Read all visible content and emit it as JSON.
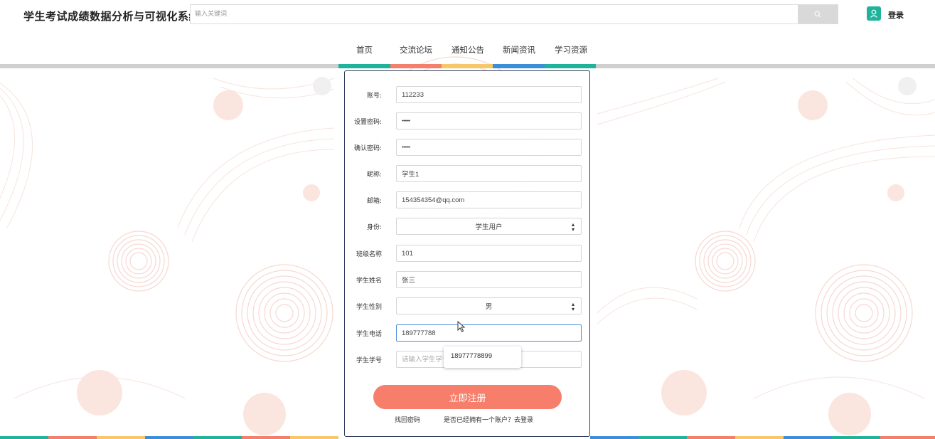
{
  "header": {
    "site_title": "学生考试成绩数据分析与可视化系统",
    "search_placeholder": "输入关键词",
    "login_label": "登录"
  },
  "nav": {
    "items": [
      "首页",
      "交流论坛",
      "通知公告",
      "新闻资讯",
      "学习资源"
    ],
    "bar_colors": [
      "#1fb39c",
      "#f47f6b",
      "#f7c86a",
      "#3b8fd9",
      "#1fb39c"
    ]
  },
  "form": {
    "fields": [
      {
        "label": "账号:",
        "value": "112233"
      },
      {
        "label": "设置密码:",
        "value": "••••••"
      },
      {
        "label": "确认密码:",
        "value": "••••••"
      },
      {
        "label": "昵称:",
        "value": "学生1"
      },
      {
        "label": "邮箱:",
        "value": "154354354@qq.com"
      },
      {
        "label": "身份:",
        "value": "学生用户"
      },
      {
        "label": "班级名称",
        "value": "101"
      },
      {
        "label": "学生姓名",
        "value": "张三"
      },
      {
        "label": "学生性别",
        "value": "男"
      },
      {
        "label": "学生电话",
        "value": "189777788"
      },
      {
        "label": "学生学号",
        "value": "",
        "placeholder": "请输入学生学号"
      }
    ],
    "autocomplete_suggestion": "18977778899",
    "register_label": "立即注册",
    "forgot_label": "找回密码",
    "login_prompt": "是否已经拥有一个账户？去登录"
  },
  "colors": {
    "accent": "#1fb39c",
    "button": "#f77e6b",
    "decoration": "#f8dcd5"
  }
}
